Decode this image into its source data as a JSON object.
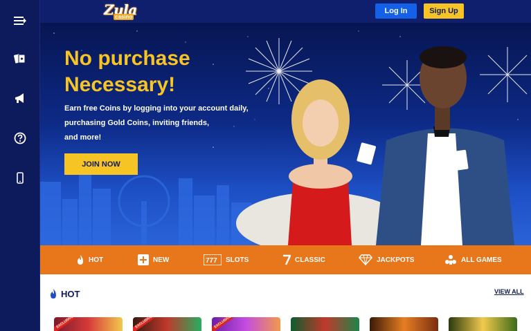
{
  "sidebar": {
    "items": [
      {
        "icon": "menu-toggle-icon"
      },
      {
        "icon": "cards-icon"
      },
      {
        "icon": "megaphone-icon"
      },
      {
        "icon": "help-icon"
      },
      {
        "icon": "mobile-icon"
      }
    ]
  },
  "header": {
    "logo_main": "Zula",
    "logo_sub": "casino",
    "login_label": "Log In",
    "signup_label": "Sign Up"
  },
  "hero": {
    "title_line1": "No purchase",
    "title_line2": "Necessary!",
    "text_line1": "Earn free Coins by logging into your account daily,",
    "text_line2": "purchasing Gold Coins, inviting friends,",
    "text_line3": "and more!",
    "cta_label": "JOIN NOW"
  },
  "categories": [
    {
      "label": "HOT",
      "icon": "flame-icon"
    },
    {
      "label": "NEW",
      "icon": "plus-icon"
    },
    {
      "label": "SLOTS",
      "icon": "slot-machine-icon"
    },
    {
      "label": "CLASSIC",
      "icon": "lucky-seven-icon"
    },
    {
      "label": "JACKPOTS",
      "icon": "diamond-icon"
    },
    {
      "label": "ALL GAMES",
      "icon": "all-games-icon"
    }
  ],
  "section": {
    "heading": "HOT",
    "view_all": "VIEW ALL"
  },
  "game_tiles": [
    {
      "badge": "EXCLUSIVE"
    },
    {
      "badge": "EXCLUSIVE"
    },
    {
      "badge": "EXCLUSIVE"
    },
    {
      "badge": ""
    },
    {
      "badge": ""
    },
    {
      "badge": ""
    }
  ],
  "colors": {
    "brand_navy": "#0d1a5c",
    "accent_yellow": "#f7c425",
    "login_blue": "#1560e8",
    "category_orange": "#e8761a"
  }
}
